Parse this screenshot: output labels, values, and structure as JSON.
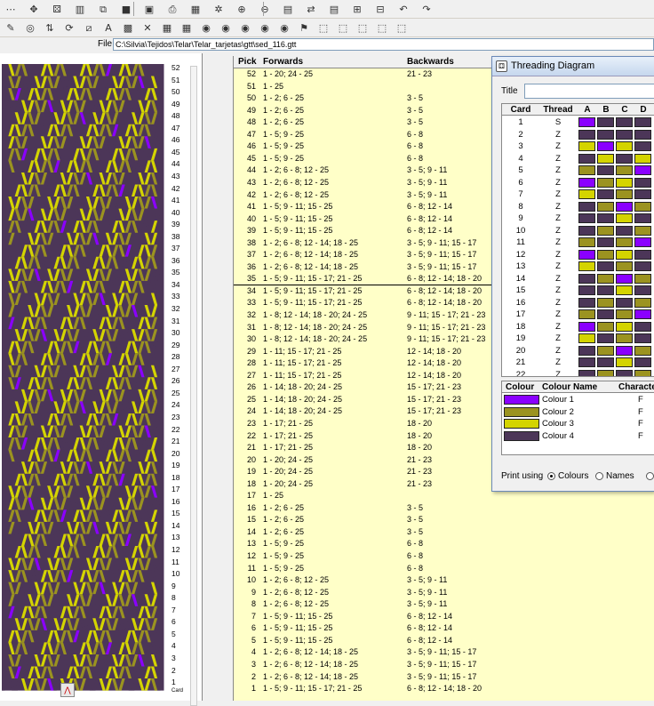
{
  "toolbar": {
    "row1": [
      {
        "name": "dots-icon",
        "glyph": "⋯"
      },
      {
        "name": "move-icon",
        "glyph": "✥"
      },
      {
        "name": "card-icon",
        "glyph": "⚄"
      },
      {
        "name": "stripes-icon",
        "glyph": "▥"
      },
      {
        "name": "copy-icon",
        "glyph": "⧉"
      },
      {
        "name": "save-icon",
        "glyph": "■"
      },
      {
        "name": "save-as-icon",
        "glyph": "▣"
      },
      {
        "name": "print-icon",
        "glyph": "⎙"
      },
      {
        "name": "grid-icon",
        "glyph": "▦"
      },
      {
        "name": "pattern-icon",
        "glyph": "✲"
      },
      {
        "name": "zoom-in-icon",
        "glyph": "⊕"
      },
      {
        "name": "zoom-out-icon",
        "glyph": "⊖"
      },
      {
        "name": "card-red-icon",
        "glyph": "▤"
      },
      {
        "name": "cards-flip-icon",
        "glyph": "⇄"
      },
      {
        "name": "card-list-icon",
        "glyph": "▤"
      },
      {
        "name": "card-add-icon",
        "glyph": "⊞"
      },
      {
        "name": "card-remove-icon",
        "glyph": "⊟"
      },
      {
        "name": "undo-icon",
        "glyph": "↶"
      },
      {
        "name": "redo-icon",
        "glyph": "↷"
      }
    ],
    "row2": [
      {
        "name": "pen-icon",
        "glyph": "✎"
      },
      {
        "name": "lifebuoy-icon",
        "glyph": "◎"
      },
      {
        "name": "flip-icon",
        "glyph": "⇅"
      },
      {
        "name": "rotate-icon",
        "glyph": "⟳"
      },
      {
        "name": "diagonal-icon",
        "glyph": "⧄"
      },
      {
        "name": "text-icon",
        "glyph": "A"
      },
      {
        "name": "fill-icon",
        "glyph": "▩"
      },
      {
        "name": "cross-icon",
        "glyph": "✕"
      },
      {
        "name": "grid-small-icon",
        "glyph": "▦"
      },
      {
        "name": "grid-blue-icon",
        "glyph": "▦"
      },
      {
        "name": "disc1-icon",
        "glyph": "◉"
      },
      {
        "name": "disc2-icon",
        "glyph": "◉"
      },
      {
        "name": "disc3-icon",
        "glyph": "◉"
      },
      {
        "name": "disc4-icon",
        "glyph": "◉"
      },
      {
        "name": "disc5-icon",
        "glyph": "◉"
      },
      {
        "name": "flag-icon",
        "glyph": "⚑"
      },
      {
        "name": "rect-select-icon",
        "glyph": "⬚"
      },
      {
        "name": "rect-copy-icon",
        "glyph": "⬚"
      },
      {
        "name": "rect-move-icon",
        "glyph": "⬚"
      },
      {
        "name": "rect-rotate-icon",
        "glyph": "⬚"
      },
      {
        "name": "rect-flip-icon",
        "glyph": "⬚"
      }
    ]
  },
  "file": {
    "label": "File",
    "path": "C:\\Silvia\\Tejidos\\Telar\\Telar_tarjetas\\gtt\\sed_116.gtt"
  },
  "pattern": {
    "colors": {
      "purple": "#8a00ff",
      "olive": "#9b9320",
      "yellow": "#d4d400",
      "dark": "#4c3658"
    },
    "rows": 52,
    "bottom_label": "Card"
  },
  "pick_table": {
    "headers": {
      "pick": "Pick",
      "forwards": "Forwards",
      "backwards": "Backwards"
    },
    "rows": [
      {
        "pick": "52",
        "forwards": "1 - 20; 24 - 25",
        "backwards": "21 - 23"
      },
      {
        "pick": "51",
        "forwards": "1 - 25",
        "backwards": ""
      },
      {
        "pick": "50",
        "forwards": "1 - 2; 6 - 25",
        "backwards": "3 - 5"
      },
      {
        "pick": "49",
        "forwards": "1 - 2; 6 - 25",
        "backwards": "3 - 5"
      },
      {
        "pick": "48",
        "forwards": "1 - 2; 6 - 25",
        "backwards": "3 - 5"
      },
      {
        "pick": "47",
        "forwards": "1 - 5; 9 - 25",
        "backwards": "6 - 8"
      },
      {
        "pick": "46",
        "forwards": "1 - 5; 9 - 25",
        "backwards": "6 - 8"
      },
      {
        "pick": "45",
        "forwards": "1 - 5; 9 - 25",
        "backwards": "6 - 8"
      },
      {
        "pick": "44",
        "forwards": "1 - 2; 6 - 8; 12 - 25",
        "backwards": "3 - 5; 9 - 11"
      },
      {
        "pick": "43",
        "forwards": "1 - 2; 6 - 8; 12 - 25",
        "backwards": "3 - 5; 9 - 11"
      },
      {
        "pick": "42",
        "forwards": "1 - 2; 6 - 8; 12 - 25",
        "backwards": "3 - 5; 9 - 11"
      },
      {
        "pick": "41",
        "forwards": "1 - 5; 9 - 11; 15 - 25",
        "backwards": "6 - 8; 12 - 14"
      },
      {
        "pick": "40",
        "forwards": "1 - 5; 9 - 11; 15 - 25",
        "backwards": "6 - 8; 12 - 14"
      },
      {
        "pick": "39",
        "forwards": "1 - 5; 9 - 11; 15 - 25",
        "backwards": "6 - 8; 12 - 14"
      },
      {
        "pick": "38",
        "forwards": "1 - 2; 6 - 8; 12 - 14; 18 - 25",
        "backwards": "3 - 5; 9 - 11; 15 - 17"
      },
      {
        "pick": "37",
        "forwards": "1 - 2; 6 - 8; 12 - 14; 18 - 25",
        "backwards": "3 - 5; 9 - 11; 15 - 17"
      },
      {
        "pick": "36",
        "forwards": "1 - 2; 6 - 8; 12 - 14; 18 - 25",
        "backwards": "3 - 5; 9 - 11; 15 - 17"
      },
      {
        "pick": "35",
        "forwards": "1 - 5; 9 - 11; 15 - 17; 21 - 25",
        "backwards": "6 - 8; 12 - 14; 18 - 20"
      },
      {
        "pick": "34",
        "forwards": "1 - 5; 9 - 11; 15 - 17; 21 - 25",
        "backwards": "6 - 8; 12 - 14; 18 - 20"
      },
      {
        "pick": "33",
        "forwards": "1 - 5; 9 - 11; 15 - 17; 21 - 25",
        "backwards": "6 - 8; 12 - 14; 18 - 20"
      },
      {
        "pick": "32",
        "forwards": "1 - 8; 12 - 14; 18 - 20; 24 - 25",
        "backwards": "9 - 11; 15 - 17; 21 - 23"
      },
      {
        "pick": "31",
        "forwards": "1 - 8; 12 - 14; 18 - 20; 24 - 25",
        "backwards": "9 - 11; 15 - 17; 21 - 23"
      },
      {
        "pick": "30",
        "forwards": "1 - 8; 12 - 14; 18 - 20; 24 - 25",
        "backwards": "9 - 11; 15 - 17; 21 - 23"
      },
      {
        "pick": "29",
        "forwards": "1 - 11; 15 - 17; 21 - 25",
        "backwards": "12 - 14; 18 - 20"
      },
      {
        "pick": "28",
        "forwards": "1 - 11; 15 - 17; 21 - 25",
        "backwards": "12 - 14; 18 - 20"
      },
      {
        "pick": "27",
        "forwards": "1 - 11; 15 - 17; 21 - 25",
        "backwards": "12 - 14; 18 - 20"
      },
      {
        "pick": "26",
        "forwards": "1 - 14; 18 - 20; 24 - 25",
        "backwards": "15 - 17; 21 - 23"
      },
      {
        "pick": "25",
        "forwards": "1 - 14; 18 - 20; 24 - 25",
        "backwards": "15 - 17; 21 - 23"
      },
      {
        "pick": "24",
        "forwards": "1 - 14; 18 - 20; 24 - 25",
        "backwards": "15 - 17; 21 - 23"
      },
      {
        "pick": "23",
        "forwards": "1 - 17; 21 - 25",
        "backwards": "18 - 20"
      },
      {
        "pick": "22",
        "forwards": "1 - 17; 21 - 25",
        "backwards": "18 - 20"
      },
      {
        "pick": "21",
        "forwards": "1 - 17; 21 - 25",
        "backwards": "18 - 20"
      },
      {
        "pick": "20",
        "forwards": "1 - 20; 24 - 25",
        "backwards": "21 - 23"
      },
      {
        "pick": "19",
        "forwards": "1 - 20; 24 - 25",
        "backwards": "21 - 23"
      },
      {
        "pick": "18",
        "forwards": "1 - 20; 24 - 25",
        "backwards": "21 - 23"
      },
      {
        "pick": "17",
        "forwards": "1 - 25",
        "backwards": ""
      },
      {
        "pick": "16",
        "forwards": "1 - 2; 6 - 25",
        "backwards": "3 - 5"
      },
      {
        "pick": "15",
        "forwards": "1 - 2; 6 - 25",
        "backwards": "3 - 5"
      },
      {
        "pick": "14",
        "forwards": "1 - 2; 6 - 25",
        "backwards": "3 - 5"
      },
      {
        "pick": "13",
        "forwards": "1 - 5; 9 - 25",
        "backwards": "6 - 8"
      },
      {
        "pick": "12",
        "forwards": "1 - 5; 9 - 25",
        "backwards": "6 - 8"
      },
      {
        "pick": "11",
        "forwards": "1 - 5; 9 - 25",
        "backwards": "6 - 8"
      },
      {
        "pick": "10",
        "forwards": "1 - 2; 6 - 8; 12 - 25",
        "backwards": "3 - 5; 9 - 11"
      },
      {
        "pick": "9",
        "forwards": "1 - 2; 6 - 8; 12 - 25",
        "backwards": "3 - 5; 9 - 11"
      },
      {
        "pick": "8",
        "forwards": "1 - 2; 6 - 8; 12 - 25",
        "backwards": "3 - 5; 9 - 11"
      },
      {
        "pick": "7",
        "forwards": "1 - 5; 9 - 11; 15 - 25",
        "backwards": "6 - 8; 12 - 14"
      },
      {
        "pick": "6",
        "forwards": "1 - 5; 9 - 11; 15 - 25",
        "backwards": "6 - 8; 12 - 14"
      },
      {
        "pick": "5",
        "forwards": "1 - 5; 9 - 11; 15 - 25",
        "backwards": "6 - 8; 12 - 14"
      },
      {
        "pick": "4",
        "forwards": "1 - 2; 6 - 8; 12 - 14; 18 - 25",
        "backwards": "3 - 5; 9 - 11; 15 - 17"
      },
      {
        "pick": "3",
        "forwards": "1 - 2; 6 - 8; 12 - 14; 18 - 25",
        "backwards": "3 - 5; 9 - 11; 15 - 17"
      },
      {
        "pick": "2",
        "forwards": "1 - 2; 6 - 8; 12 - 14; 18 - 25",
        "backwards": "3 - 5; 9 - 11; 15 - 17"
      },
      {
        "pick": "1",
        "forwards": "1 - 5; 9 - 11; 15 - 17; 21 - 25",
        "backwards": "6 - 8; 12 - 14; 18 - 20"
      }
    ]
  },
  "threading": {
    "title": "Threading Diagram",
    "title_label": "Title",
    "title_value": "",
    "headers": {
      "card": "Card",
      "thread": "Thread",
      "a": "A",
      "b": "B",
      "c": "C",
      "d": "D"
    },
    "palette": {
      "p": "#8a00ff",
      "o": "#9b9320",
      "y": "#d4d400",
      "d": "#4c3658"
    },
    "cards": [
      {
        "card": "1",
        "thread": "S",
        "holes": [
          "p",
          "d",
          "d",
          "d"
        ]
      },
      {
        "card": "2",
        "thread": "Z",
        "holes": [
          "d",
          "d",
          "d",
          "d"
        ]
      },
      {
        "card": "3",
        "thread": "Z",
        "holes": [
          "y",
          "p",
          "y",
          "d"
        ]
      },
      {
        "card": "4",
        "thread": "Z",
        "holes": [
          "d",
          "y",
          "d",
          "y"
        ]
      },
      {
        "card": "5",
        "thread": "Z",
        "holes": [
          "o",
          "d",
          "o",
          "p"
        ]
      },
      {
        "card": "6",
        "thread": "Z",
        "holes": [
          "p",
          "o",
          "y",
          "d"
        ]
      },
      {
        "card": "7",
        "thread": "Z",
        "holes": [
          "y",
          "d",
          "o",
          "d"
        ]
      },
      {
        "card": "8",
        "thread": "Z",
        "holes": [
          "d",
          "o",
          "p",
          "o"
        ]
      },
      {
        "card": "9",
        "thread": "Z",
        "holes": [
          "d",
          "d",
          "y",
          "d"
        ]
      },
      {
        "card": "10",
        "thread": "Z",
        "holes": [
          "d",
          "o",
          "d",
          "o"
        ]
      },
      {
        "card": "11",
        "thread": "Z",
        "holes": [
          "o",
          "d",
          "o",
          "p"
        ]
      },
      {
        "card": "12",
        "thread": "Z",
        "holes": [
          "p",
          "o",
          "y",
          "d"
        ]
      },
      {
        "card": "13",
        "thread": "Z",
        "holes": [
          "y",
          "d",
          "o",
          "d"
        ]
      },
      {
        "card": "14",
        "thread": "Z",
        "holes": [
          "d",
          "o",
          "p",
          "o"
        ]
      },
      {
        "card": "15",
        "thread": "Z",
        "holes": [
          "d",
          "d",
          "y",
          "d"
        ]
      },
      {
        "card": "16",
        "thread": "Z",
        "holes": [
          "d",
          "o",
          "d",
          "o"
        ]
      },
      {
        "card": "17",
        "thread": "Z",
        "holes": [
          "o",
          "d",
          "o",
          "p"
        ]
      },
      {
        "card": "18",
        "thread": "Z",
        "holes": [
          "p",
          "o",
          "y",
          "d"
        ]
      },
      {
        "card": "19",
        "thread": "Z",
        "holes": [
          "y",
          "d",
          "o",
          "d"
        ]
      },
      {
        "card": "20",
        "thread": "Z",
        "holes": [
          "d",
          "o",
          "p",
          "o"
        ]
      },
      {
        "card": "21",
        "thread": "Z",
        "holes": [
          "d",
          "d",
          "y",
          "d"
        ]
      },
      {
        "card": "22",
        "thread": "Z",
        "holes": [
          "d",
          "o",
          "d",
          "o"
        ]
      }
    ],
    "colour_headers": {
      "colour": "Colour",
      "name": "Colour Name",
      "char": "Characte"
    },
    "colours": [
      {
        "hex": "#8a00ff",
        "name": "Colour 1",
        "char": "F"
      },
      {
        "hex": "#9b9320",
        "name": "Colour 2",
        "char": "F"
      },
      {
        "hex": "#d4d400",
        "name": "Colour 3",
        "char": "F"
      },
      {
        "hex": "#4c3658",
        "name": "Colour 4",
        "char": "F"
      }
    ],
    "print": {
      "label": "Print using",
      "options": [
        "Colours",
        "Names",
        ""
      ],
      "selected": "Colours"
    }
  }
}
